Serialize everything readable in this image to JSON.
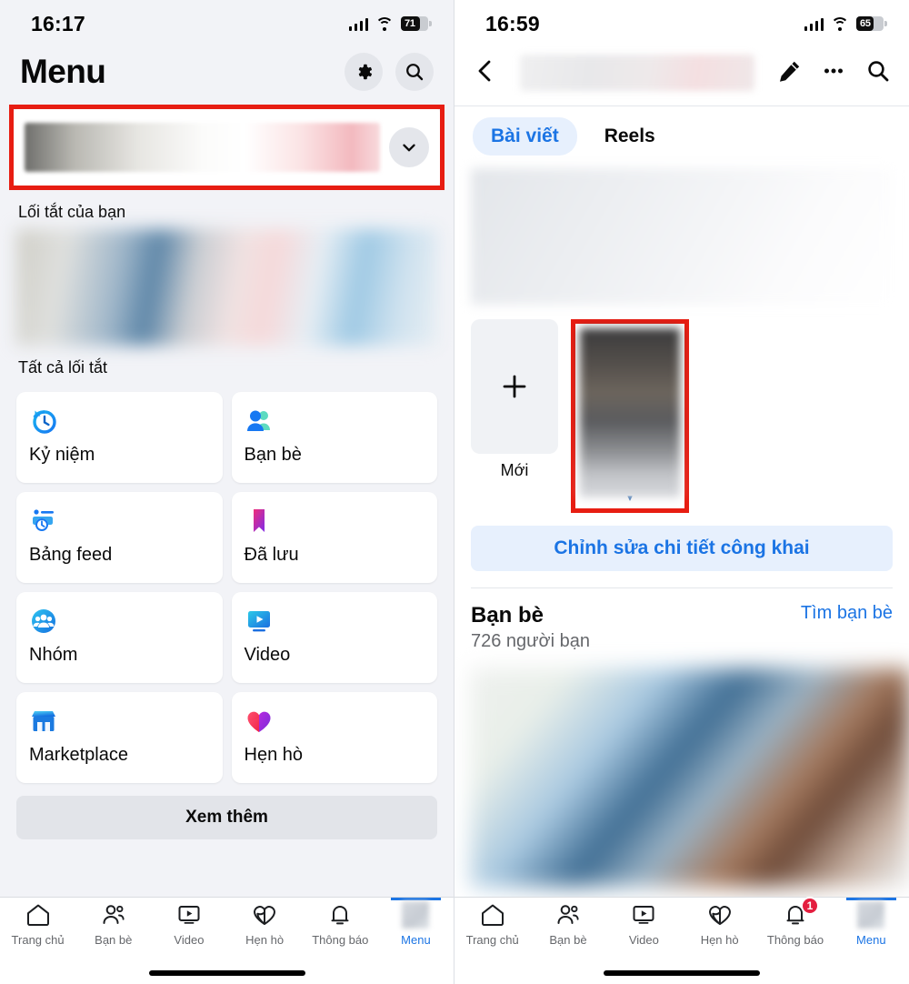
{
  "left": {
    "status": {
      "time": "16:17",
      "battery": "71"
    },
    "header": {
      "title": "Menu",
      "settings_icon": "gear-icon",
      "search_icon": "search-icon"
    },
    "profile": {
      "expand_icon": "chevron-down-icon"
    },
    "sections": {
      "shortcuts_label": "Lối tắt của bạn",
      "all_shortcuts_label": "Tất cả lối tắt"
    },
    "grid": [
      {
        "label": "Kỷ niệm",
        "icon": "memories-clock-icon"
      },
      {
        "label": "Bạn bè",
        "icon": "friends-icon"
      },
      {
        "label": "Bảng feed",
        "icon": "feeds-icon"
      },
      {
        "label": "Đã lưu",
        "icon": "bookmark-icon"
      },
      {
        "label": "Nhóm",
        "icon": "groups-icon"
      },
      {
        "label": "Video",
        "icon": "video-icon"
      },
      {
        "label": "Marketplace",
        "icon": "marketplace-icon"
      },
      {
        "label": "Hẹn hò",
        "icon": "dating-heart-icon"
      }
    ],
    "see_more": "Xem thêm",
    "tabbar": [
      {
        "label": "Trang chủ",
        "icon": "home-icon",
        "active": false,
        "badge": ""
      },
      {
        "label": "Bạn bè",
        "icon": "friends-icon",
        "active": false,
        "badge": ""
      },
      {
        "label": "Video",
        "icon": "video-icon",
        "active": false,
        "badge": ""
      },
      {
        "label": "Hẹn hò",
        "icon": "dating-heart-icon",
        "active": false,
        "badge": ""
      },
      {
        "label": "Thông báo",
        "icon": "bell-icon",
        "active": false,
        "badge": ""
      },
      {
        "label": "Menu",
        "icon": "avatar-icon",
        "active": true,
        "badge": ""
      }
    ]
  },
  "right": {
    "status": {
      "time": "16:59",
      "battery": "65"
    },
    "header": {
      "back_icon": "chevron-left-icon",
      "edit_icon": "pencil-icon",
      "more_icon": "ellipsis-icon",
      "search_icon": "search-icon"
    },
    "tabs": [
      {
        "label": "Bài viết",
        "active": true
      },
      {
        "label": "Reels",
        "active": false
      }
    ],
    "story": {
      "new_label": "Mới",
      "plus_icon": "plus-icon",
      "caret_icon": "caret-down-icon"
    },
    "edit_public": "Chỉnh sửa chi tiết công khai",
    "friends": {
      "title": "Bạn bè",
      "count": "726 người bạn",
      "find_link": "Tìm bạn bè"
    },
    "tabbar": [
      {
        "label": "Trang chủ",
        "icon": "home-icon",
        "active": false,
        "badge": ""
      },
      {
        "label": "Bạn bè",
        "icon": "friends-icon",
        "active": false,
        "badge": ""
      },
      {
        "label": "Video",
        "icon": "video-icon",
        "active": false,
        "badge": ""
      },
      {
        "label": "Hẹn hò",
        "icon": "dating-heart-icon",
        "active": false,
        "badge": ""
      },
      {
        "label": "Thông báo",
        "icon": "bell-icon",
        "active": false,
        "badge": "1"
      },
      {
        "label": "Menu",
        "icon": "avatar-icon",
        "active": true,
        "badge": ""
      }
    ]
  },
  "colors": {
    "accent": "#1b74e4",
    "highlight": "#e71d12",
    "badge": "#e41e3f",
    "bg": "#f2f3f7"
  }
}
